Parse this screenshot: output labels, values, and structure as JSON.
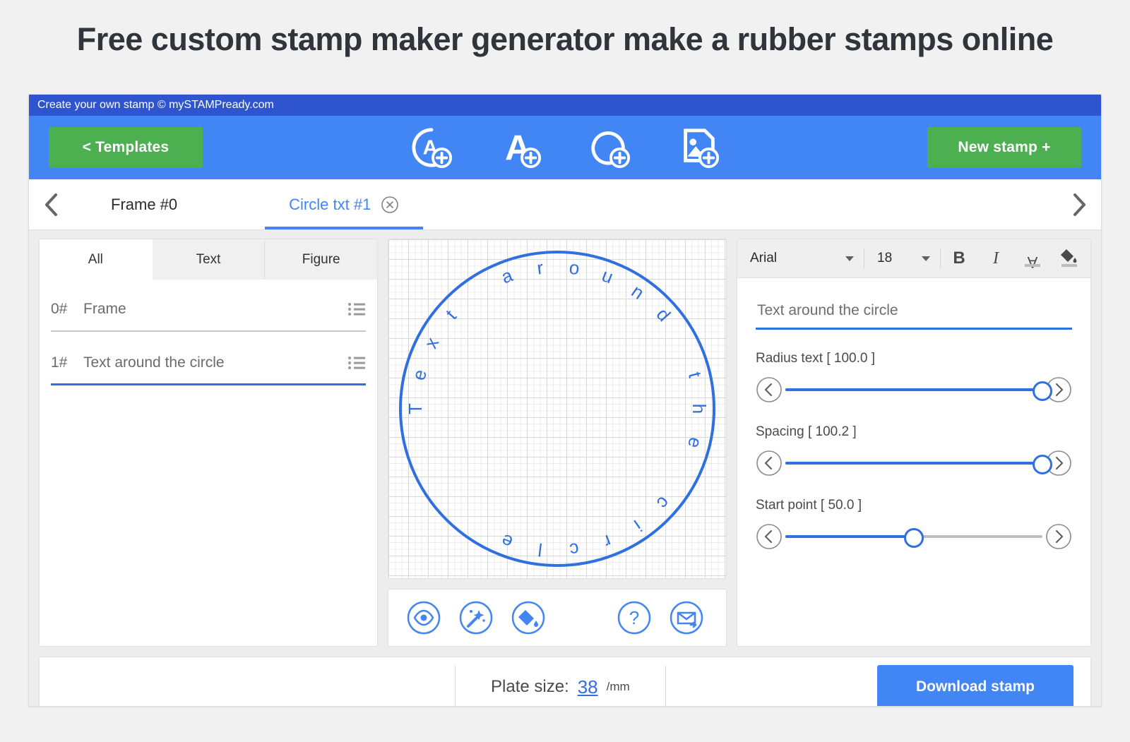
{
  "page": {
    "title": "Free custom stamp maker generator make a rubber stamps online"
  },
  "app": {
    "brandbar": "Create your own stamp © mySTAMPready.com",
    "toolbar": {
      "templates_label": "<  Templates",
      "new_stamp_label": "New stamp +",
      "icons": [
        {
          "name": "add-circle-text-icon"
        },
        {
          "name": "add-text-icon"
        },
        {
          "name": "add-circle-icon"
        },
        {
          "name": "add-image-icon"
        }
      ],
      "green": "#4caf50",
      "blue": "#4285f4",
      "header_blue": "#2f54cf"
    },
    "object_tabs": {
      "prev_icon": "chevron-left-icon",
      "next_icon": "chevron-right-icon",
      "items": [
        {
          "label": "Frame #0",
          "active": false,
          "closable": false
        },
        {
          "label": "Circle txt #1",
          "active": true,
          "closable": true
        }
      ]
    },
    "left_panel": {
      "filter_tabs": [
        {
          "label": "All",
          "active": true
        },
        {
          "label": "Text",
          "active": false
        },
        {
          "label": "Figure",
          "active": false
        }
      ],
      "layers": [
        {
          "index": "0#",
          "name": "Frame",
          "selected": false
        },
        {
          "index": "1#",
          "name": "Text around the circle",
          "selected": true
        }
      ]
    },
    "canvas": {
      "stamp_text": "Text around the circle",
      "stroke_color": "#2f6fe0",
      "tools": [
        {
          "name": "preview-eye-icon",
          "label": "Preview"
        },
        {
          "name": "magic-wand-icon",
          "label": "Effects"
        },
        {
          "name": "paint-bucket-icon",
          "label": "Fill color"
        },
        {
          "name": "help-question-icon",
          "label": "Help"
        },
        {
          "name": "send-mail-icon",
          "label": "Send by mail"
        }
      ]
    },
    "right_panel": {
      "font_family": "Arial",
      "font_size": "18",
      "format_buttons": [
        {
          "name": "bold-button",
          "label": "B"
        },
        {
          "name": "italic-button",
          "label": "I"
        },
        {
          "name": "text-color-button",
          "label": "A"
        },
        {
          "name": "fill-color-button",
          "label": "Fill"
        }
      ],
      "text_value": "Text around the circle",
      "text_placeholder": "Text around the circle",
      "sliders": [
        {
          "label": "Radius text [ 100.0 ]",
          "name": "radius-text",
          "percent": 100
        },
        {
          "label": "Spacing [ 100.2 ]",
          "name": "spacing",
          "percent": 100
        },
        {
          "label": "Start point [ 50.0 ]",
          "name": "start-point",
          "percent": 50
        }
      ]
    },
    "footer": {
      "plate_label": "Plate size:",
      "plate_value": "38",
      "plate_unit": "/mm",
      "download_label": "Download stamp"
    }
  }
}
